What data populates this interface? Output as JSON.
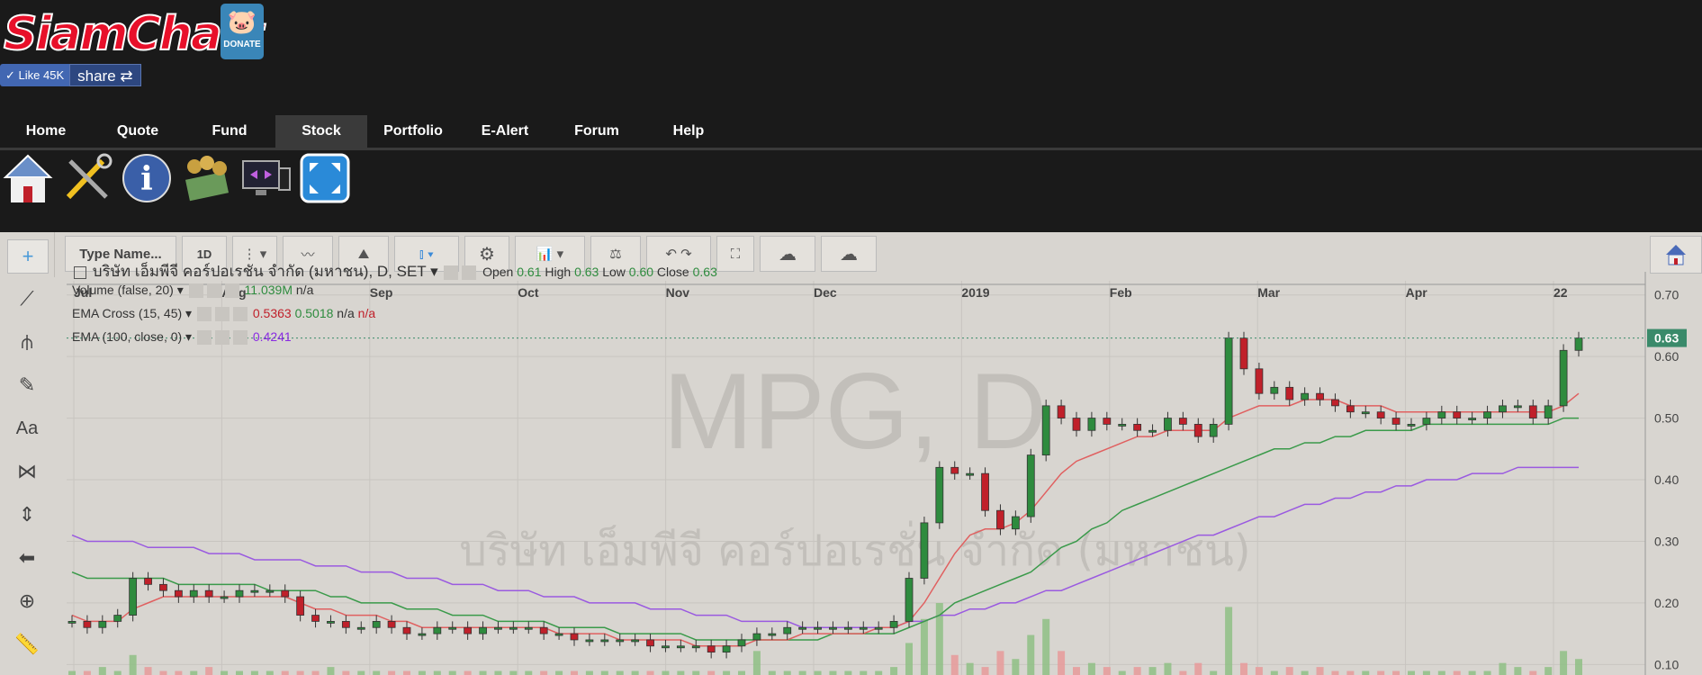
{
  "brand": {
    "logo_text": "SiamChart",
    "donate_label": "DONATE"
  },
  "social": {
    "like_label": "Like",
    "like_count": "45K",
    "share_label": "share"
  },
  "nav": {
    "tabs": [
      "Home",
      "Quote",
      "Fund",
      "Stock",
      "Portfolio",
      "E-Alert",
      "Forum",
      "Help"
    ],
    "active": "Stock"
  },
  "toolbar": {
    "symbol_placeholder": "Type Name...",
    "interval": "1D"
  },
  "chart_header": {
    "title": "บริษัท เอ็มพีจี คอร์ปอเรชัน จำกัด (มหาชน), D, SET",
    "open_label": "Open",
    "open": "0.61",
    "high_label": "High",
    "high": "0.63",
    "low_label": "Low",
    "low": "0.60",
    "close_label": "Close",
    "close": "0.63"
  },
  "indicators": [
    {
      "name": "Volume (false, 20)",
      "v1": "11.039M",
      "v2": "n/a"
    },
    {
      "name": "EMA Cross (15, 45)",
      "v1": "0.5363",
      "v2": "0.5018",
      "v3": "n/a",
      "v4": "n/a"
    },
    {
      "name": "EMA (100, close, 0)",
      "v1": "0.4241"
    }
  ],
  "watermark": {
    "symbol": "MPG, D",
    "company": "บริษัท เอ็มพีจี คอร์ปอเรชั่น จำกัด (มหาชน)"
  },
  "colors": {
    "up": "#2e8b3e",
    "down": "#c0202a",
    "ema_fast": "#e06060",
    "ema_slow": "#3a9a4a",
    "ema_100": "#9a5ae0",
    "last_price": "#3a8a6a"
  },
  "chart_data": {
    "type": "candlestick",
    "x_ticks": [
      "Jul",
      "Aug",
      "Sep",
      "Oct",
      "Nov",
      "Dec",
      "2019",
      "Feb",
      "Mar",
      "Apr",
      "22"
    ],
    "y_ticks": [
      "0.70",
      "0.60",
      "0.50",
      "0.40",
      "0.30",
      "0.20",
      "0.10"
    ],
    "ylim": [
      0.08,
      0.72
    ],
    "last_price": "0.63",
    "close_series": [
      0.17,
      0.16,
      0.17,
      0.18,
      0.24,
      0.23,
      0.22,
      0.21,
      0.22,
      0.21,
      0.21,
      0.22,
      0.22,
      0.22,
      0.21,
      0.18,
      0.17,
      0.17,
      0.16,
      0.16,
      0.17,
      0.16,
      0.15,
      0.15,
      0.16,
      0.16,
      0.15,
      0.16,
      0.16,
      0.16,
      0.16,
      0.15,
      0.15,
      0.14,
      0.14,
      0.14,
      0.14,
      0.14,
      0.13,
      0.13,
      0.13,
      0.13,
      0.12,
      0.13,
      0.14,
      0.15,
      0.15,
      0.16,
      0.16,
      0.16,
      0.16,
      0.16,
      0.16,
      0.16,
      0.17,
      0.24,
      0.33,
      0.42,
      0.41,
      0.41,
      0.35,
      0.32,
      0.34,
      0.44,
      0.52,
      0.5,
      0.48,
      0.5,
      0.49,
      0.49,
      0.48,
      0.48,
      0.5,
      0.49,
      0.47,
      0.49,
      0.63,
      0.58,
      0.54,
      0.55,
      0.53,
      0.54,
      0.53,
      0.52,
      0.51,
      0.51,
      0.5,
      0.49,
      0.49,
      0.5,
      0.51,
      0.5,
      0.5,
      0.51,
      0.52,
      0.52,
      0.5,
      0.52,
      0.61,
      0.63
    ],
    "ema_fast": [
      0.18,
      0.17,
      0.17,
      0.17,
      0.19,
      0.2,
      0.21,
      0.21,
      0.21,
      0.21,
      0.21,
      0.21,
      0.21,
      0.21,
      0.21,
      0.2,
      0.19,
      0.19,
      0.18,
      0.18,
      0.18,
      0.17,
      0.17,
      0.16,
      0.16,
      0.16,
      0.16,
      0.16,
      0.16,
      0.16,
      0.16,
      0.16,
      0.15,
      0.15,
      0.15,
      0.15,
      0.14,
      0.14,
      0.14,
      0.14,
      0.14,
      0.13,
      0.13,
      0.13,
      0.13,
      0.14,
      0.14,
      0.14,
      0.15,
      0.15,
      0.15,
      0.15,
      0.15,
      0.16,
      0.16,
      0.17,
      0.2,
      0.24,
      0.28,
      0.31,
      0.32,
      0.32,
      0.33,
      0.35,
      0.38,
      0.41,
      0.43,
      0.44,
      0.45,
      0.46,
      0.47,
      0.47,
      0.48,
      0.48,
      0.48,
      0.48,
      0.5,
      0.51,
      0.52,
      0.52,
      0.52,
      0.53,
      0.53,
      0.53,
      0.52,
      0.52,
      0.52,
      0.51,
      0.51,
      0.51,
      0.51,
      0.51,
      0.51,
      0.51,
      0.51,
      0.51,
      0.51,
      0.51,
      0.52,
      0.54
    ],
    "ema_slow": [
      0.25,
      0.24,
      0.24,
      0.24,
      0.24,
      0.24,
      0.24,
      0.23,
      0.23,
      0.23,
      0.23,
      0.23,
      0.23,
      0.22,
      0.22,
      0.22,
      0.22,
      0.21,
      0.21,
      0.2,
      0.2,
      0.2,
      0.19,
      0.19,
      0.19,
      0.18,
      0.18,
      0.18,
      0.17,
      0.17,
      0.17,
      0.17,
      0.16,
      0.16,
      0.16,
      0.16,
      0.15,
      0.15,
      0.15,
      0.15,
      0.15,
      0.14,
      0.14,
      0.14,
      0.14,
      0.14,
      0.14,
      0.14,
      0.14,
      0.14,
      0.15,
      0.15,
      0.15,
      0.15,
      0.15,
      0.16,
      0.17,
      0.18,
      0.2,
      0.21,
      0.22,
      0.23,
      0.24,
      0.25,
      0.27,
      0.29,
      0.3,
      0.32,
      0.33,
      0.35,
      0.36,
      0.37,
      0.38,
      0.39,
      0.4,
      0.41,
      0.42,
      0.43,
      0.44,
      0.45,
      0.45,
      0.46,
      0.46,
      0.47,
      0.47,
      0.48,
      0.48,
      0.48,
      0.48,
      0.49,
      0.49,
      0.49,
      0.49,
      0.49,
      0.49,
      0.49,
      0.49,
      0.49,
      0.5,
      0.5
    ],
    "ema_100": [
      0.31,
      0.3,
      0.3,
      0.3,
      0.3,
      0.29,
      0.29,
      0.29,
      0.29,
      0.28,
      0.28,
      0.28,
      0.27,
      0.27,
      0.27,
      0.27,
      0.26,
      0.26,
      0.26,
      0.25,
      0.25,
      0.25,
      0.24,
      0.24,
      0.24,
      0.23,
      0.23,
      0.23,
      0.22,
      0.22,
      0.22,
      0.21,
      0.21,
      0.21,
      0.2,
      0.2,
      0.2,
      0.2,
      0.19,
      0.19,
      0.19,
      0.18,
      0.18,
      0.18,
      0.17,
      0.17,
      0.17,
      0.17,
      0.16,
      0.16,
      0.16,
      0.16,
      0.16,
      0.16,
      0.16,
      0.17,
      0.17,
      0.18,
      0.18,
      0.19,
      0.19,
      0.2,
      0.2,
      0.21,
      0.22,
      0.22,
      0.23,
      0.24,
      0.25,
      0.26,
      0.27,
      0.28,
      0.29,
      0.3,
      0.31,
      0.31,
      0.32,
      0.33,
      0.34,
      0.34,
      0.35,
      0.36,
      0.36,
      0.37,
      0.37,
      0.38,
      0.38,
      0.39,
      0.39,
      0.4,
      0.4,
      0.4,
      0.41,
      0.41,
      0.41,
      0.42,
      0.42,
      0.42,
      0.42,
      0.42
    ],
    "volume": [
      1,
      1,
      2,
      1,
      5,
      2,
      1,
      1,
      1,
      2,
      1,
      1,
      1,
      1,
      1,
      1,
      1,
      2,
      1,
      1,
      1,
      1,
      1,
      1,
      1,
      1,
      1,
      1,
      1,
      1,
      1,
      1,
      1,
      1,
      1,
      1,
      1,
      1,
      1,
      1,
      1,
      1,
      1,
      1,
      1,
      6,
      1,
      1,
      1,
      1,
      1,
      1,
      1,
      1,
      2,
      8,
      14,
      18,
      5,
      3,
      2,
      6,
      4,
      10,
      14,
      6,
      2,
      3,
      2,
      1,
      2,
      2,
      3,
      1,
      3,
      1,
      17,
      3,
      2,
      1,
      2,
      1,
      2,
      1,
      1,
      1,
      1,
      1,
      1,
      1,
      1,
      1,
      1,
      1,
      3,
      2,
      1,
      2,
      6,
      4
    ]
  }
}
